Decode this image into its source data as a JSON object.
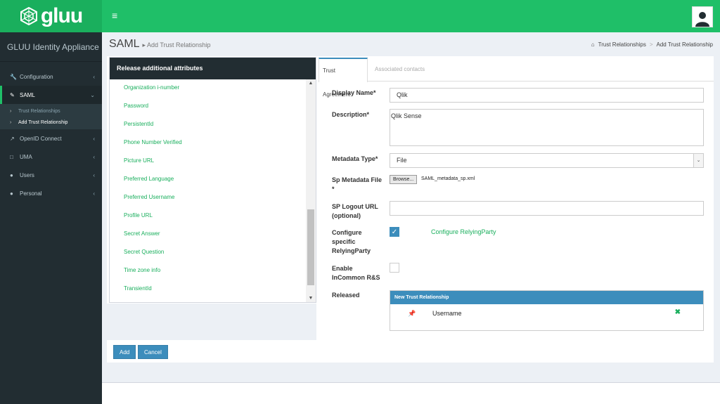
{
  "brand": {
    "name": "gluu"
  },
  "header": {
    "menu_icon": "hamburger-icon",
    "avatar_icon": "user-icon"
  },
  "sidebar": {
    "title": "GLUU Identity Appliance",
    "items": [
      {
        "label": "Configuration",
        "icon": "wrench-icon"
      },
      {
        "label": "SAML",
        "icon": "edit-icon"
      },
      {
        "label": "OpenID Connect",
        "icon": "external-link-icon"
      },
      {
        "label": "UMA",
        "icon": "folder-icon"
      },
      {
        "label": "Users",
        "icon": "users-icon"
      },
      {
        "label": "Personal",
        "icon": "user-icon"
      }
    ],
    "saml_sub": [
      "Trust Relationships",
      "Add Trust Relationship"
    ]
  },
  "page": {
    "title": "SAML",
    "subtitle": "Add Trust Relationship"
  },
  "breadcrumb": [
    "Trust Relationships",
    "Add Trust Relationship"
  ],
  "attributes": {
    "heading": "Release additional attributes",
    "items": [
      "Organization i-number",
      "Password",
      "PersistentId",
      "Phone Number Verified",
      "Picture URL",
      "Preferred Language",
      "Preferred Username",
      "Profile URL",
      "Secret Answer",
      "Secret Question",
      "Time zone info",
      "TransientId"
    ]
  },
  "tabs": [
    "Trust Agreement",
    "Associated contacts"
  ],
  "form": {
    "display_name_label": "Display Name*",
    "display_name_value": "Qlik",
    "description_label": "Description*",
    "description_value": "Qlik Sense",
    "metadata_type_label": "Metadata Type*",
    "metadata_type_value": "File",
    "sp_metadata_label_1": "Sp Metadata File",
    "sp_metadata_label_2": "*",
    "browse_label": "Browse...",
    "file_name": "SAML_metadata_sp.xml",
    "sp_logout_label_1": "SP Logout URL",
    "sp_logout_label_2": "(optional)",
    "sp_logout_value": "",
    "configure_label_1": "Configure",
    "configure_label_2": "specific",
    "configure_label_3": "RelyingParty",
    "configure_checked": true,
    "configure_link": "Configure RelyingParty",
    "incommon_label_1": "Enable",
    "incommon_label_2": "InCommon R&S",
    "incommon_checked": false,
    "released_label": "Released",
    "released_heading": "New Trust Relationship",
    "released_items": [
      "Username"
    ]
  },
  "buttons": {
    "add": "Add",
    "cancel": "Cancel"
  },
  "colors": {
    "brand_green": "#1fbf68",
    "sidebar_dark": "#222d32",
    "primary_blue": "#3c8dbc",
    "link_green": "#1aaf5d"
  }
}
